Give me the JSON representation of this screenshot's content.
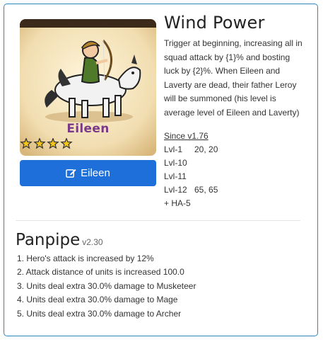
{
  "hero": {
    "name": "Eileen",
    "stars": 4,
    "button_label": "Eileen",
    "name_color": "#7a3a86",
    "button_color": "#1e6fd9"
  },
  "skill": {
    "title": "Wind Power",
    "description": "Trigger at beginning, increasing all in squad attack by {1}% and bosting luck by {2}%. When Eileen and Laverty are dead, their father Leroy will be summoned (his level is average level of Eileen and Laverty)",
    "since": "Since v1.76",
    "levels": [
      {
        "level": "Lvl-1",
        "values": "20, 20"
      },
      {
        "level": "Lvl-10",
        "values": ""
      },
      {
        "level": "Lvl-11",
        "values": ""
      },
      {
        "level": "Lvl-12",
        "values": "65, 65"
      }
    ],
    "extra": "+ HA-5"
  },
  "item": {
    "title": "Panpipe",
    "version": "v2.30",
    "effects": [
      "1. Hero's attack is increased by 12%",
      "2. Attack distance of units is increased 100.0",
      "3. Units deal extra 30.0% damage to Musketeer",
      "4. Units deal extra 30.0% damage to Mage",
      "5. Units deal extra 30.0% damage to Archer"
    ]
  },
  "colors": {
    "border": "#2e86c1",
    "star": "#f5c518"
  }
}
